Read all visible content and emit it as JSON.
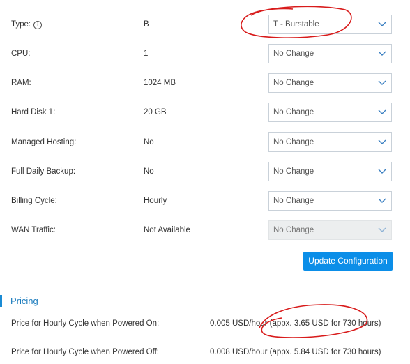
{
  "config_rows": [
    {
      "label": "Type:",
      "value": "B",
      "select": "T - Burstable",
      "disabled": false
    },
    {
      "label": "CPU:",
      "value": "1",
      "select": "No Change",
      "disabled": false
    },
    {
      "label": "RAM:",
      "value": "1024 MB",
      "select": "No Change",
      "disabled": false
    },
    {
      "label": "Hard Disk 1:",
      "value": "20 GB",
      "select": "No Change",
      "disabled": false
    },
    {
      "label": "Managed Hosting:",
      "value": "No",
      "select": "No Change",
      "disabled": false
    },
    {
      "label": "Full Daily Backup:",
      "value": "No",
      "select": "No Change",
      "disabled": false
    },
    {
      "label": "Billing Cycle:",
      "value": "Hourly",
      "select": "No Change",
      "disabled": false
    },
    {
      "label": "WAN Traffic:",
      "value": "Not Available",
      "select": "No Change",
      "disabled": true
    }
  ],
  "type_info_icon": "i",
  "update_button": "Update Configuration",
  "pricing": {
    "title": "Pricing",
    "rows": [
      {
        "label": "Price for Hourly Cycle when Powered On:",
        "value": "0.005 USD/hour (appx. 3.65 USD for 730 hours)"
      },
      {
        "label": "Price for Hourly Cycle when Powered Off:",
        "value": "0.008 USD/hour (appx. 5.84 USD for 730 hours)"
      }
    ]
  },
  "colors": {
    "accent": "#0b8ee8",
    "pricing_title": "#1a7bbd",
    "annotation": "#d81b1b"
  }
}
